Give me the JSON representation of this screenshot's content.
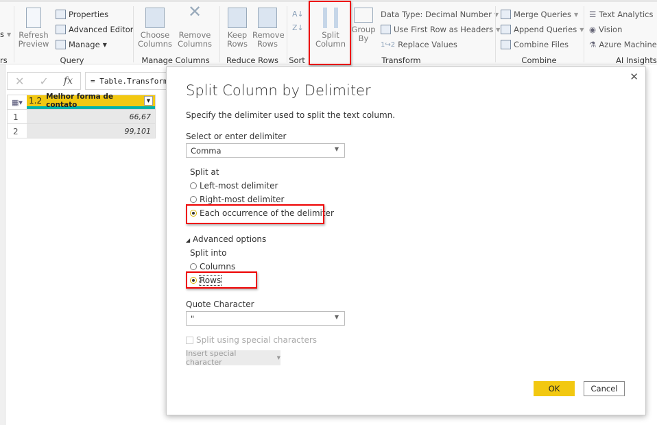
{
  "ribbon": {
    "partial_left_label": "s",
    "partial_left_group": "rs",
    "refresh_preview": [
      "Refresh",
      "Preview"
    ],
    "properties": "Properties",
    "advanced_editor": "Advanced Editor",
    "manage": "Manage",
    "query_group": "Query",
    "choose_columns": [
      "Choose",
      "Columns"
    ],
    "remove_columns": [
      "Remove",
      "Columns"
    ],
    "manage_columns_group": "Manage Columns",
    "keep_rows": [
      "Keep",
      "Rows"
    ],
    "remove_rows": [
      "Remove",
      "Rows"
    ],
    "reduce_rows_group": "Reduce Rows",
    "sort_group": "Sort",
    "split_column": [
      "Split",
      "Column"
    ],
    "group_by": [
      "Group",
      "By"
    ],
    "data_type": "Data Type: Decimal Number",
    "use_first_row": "Use First Row as Headers",
    "replace_values": "Replace Values",
    "transform_group": "Transform",
    "merge_queries": "Merge Queries",
    "append_queries": "Append Queries",
    "combine_files": "Combine Files",
    "combine_group": "Combine",
    "text_analytics": "Text Analytics",
    "vision": "Vision",
    "azure_ml": "Azure Machine",
    "ai_group": "AI Insights"
  },
  "formula": {
    "text": "= Table.TransformColumnTypes"
  },
  "table": {
    "type_label": "1.2",
    "column": "Melhor forma de contato",
    "rows": [
      {
        "n": "1",
        "v": "66,67"
      },
      {
        "n": "2",
        "v": "99,101"
      }
    ]
  },
  "dialog": {
    "title": "Split Column by Delimiter",
    "description": "Specify the delimiter used to split the text column.",
    "delimiter_label": "Select or enter delimiter",
    "delimiter_value": "Comma",
    "split_at_label": "Split at",
    "split_at_options": [
      "Left-most delimiter",
      "Right-most delimiter",
      "Each occurrence of the delimiter"
    ],
    "split_at_selected": 2,
    "advanced_label": "Advanced options",
    "split_into_label": "Split into",
    "split_into_options": [
      "Columns",
      "Rows"
    ],
    "split_into_selected": 1,
    "quote_label": "Quote Character",
    "quote_value": "\"",
    "special_chars_label": "Split using special characters",
    "insert_special": "Insert special character",
    "ok": "OK",
    "cancel": "Cancel",
    "close": "✕"
  },
  "colors": {
    "accent": "#f2c811",
    "highlight": "#e00000",
    "teal": "#00b2a9"
  }
}
